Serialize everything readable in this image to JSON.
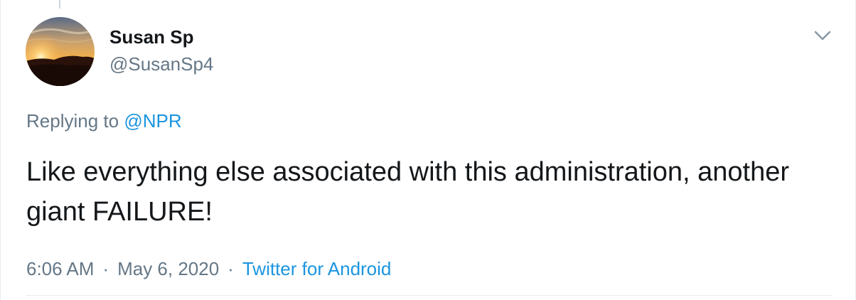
{
  "tweet": {
    "display_name": "Susan Sp",
    "handle": "@SusanSp4",
    "replying_prefix": "Replying to",
    "replying_to": "@NPR",
    "text": "Like everything else associated with this administration, another giant FAILURE!",
    "time": "6:06 AM",
    "separator": "·",
    "date": "May 6, 2020",
    "source": "Twitter for Android"
  },
  "icons": {
    "avatar": "sunset-photo-avatar",
    "menu": "chevron-down-icon"
  },
  "colors": {
    "link": "#1b95e0",
    "secondary_text": "#657786",
    "primary_text": "#14171a",
    "border": "#e6ecf0"
  }
}
